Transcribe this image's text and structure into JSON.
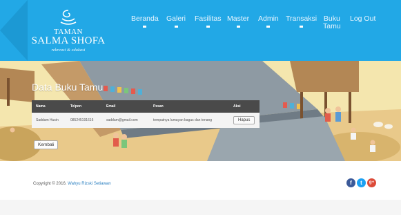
{
  "brand": {
    "line1": "TAMAN",
    "line2": "SALMA SHOFA",
    "tagline": "rekreasi & edukasi"
  },
  "nav": {
    "items": [
      {
        "label": "Beranda"
      },
      {
        "label": "Galeri"
      },
      {
        "label": "Fasilitas"
      },
      {
        "label": "Master"
      },
      {
        "label": "Admin"
      },
      {
        "label": "Transaksi"
      },
      {
        "label_line1": "Buku",
        "label_line2": "Tamu"
      },
      {
        "label": "Log Out"
      }
    ]
  },
  "page": {
    "heading": "Data Buku Tamu"
  },
  "table": {
    "headers": [
      "Nama",
      "Telpon",
      "Email",
      "Pesan",
      "Aksi"
    ],
    "rows": [
      {
        "nama": "Saddam Husin",
        "telpon": "085245191616",
        "email": "saddam@gmail.com",
        "pesan": "tempatnya lumayan bagus dan tenang",
        "action": "Hapus"
      }
    ]
  },
  "buttons": {
    "back": "Kembali"
  },
  "footer": {
    "copyright_prefix": "Copyright © 2016.",
    "author": "Wahyu Rizski Setiawan",
    "socials": [
      {
        "icon": "facebook-icon",
        "glyph": "f",
        "color": "#3b5998"
      },
      {
        "icon": "twitter-icon",
        "glyph": "t",
        "color": "#1da1f2"
      },
      {
        "icon": "google-plus-icon",
        "glyph": "g+",
        "color": "#dc4a38"
      }
    ]
  },
  "colors": {
    "header": "#22a8e6",
    "table_header": "#4a4a4a",
    "link": "#2a7fc0"
  }
}
